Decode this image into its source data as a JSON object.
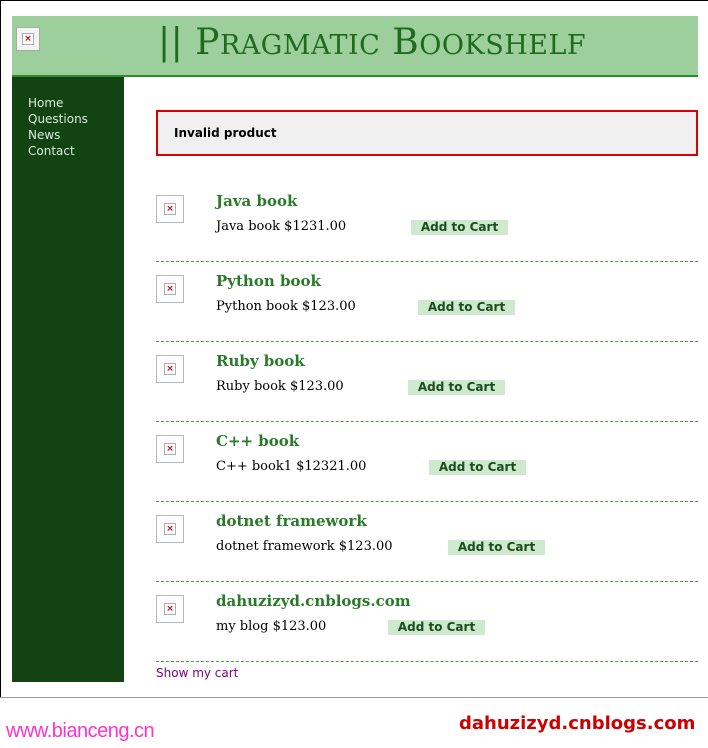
{
  "header": {
    "brand_first": "|| P",
    "brand_part1": "RAGMATIC",
    "brand_b": " B",
    "brand_part2": "OOKSHELF",
    "logo_icon": "broken-image-icon"
  },
  "nav": {
    "items": [
      "Home",
      "Questions",
      "News",
      "Contact"
    ]
  },
  "notice": {
    "text": "Invalid product"
  },
  "products": [
    {
      "title": "Java book",
      "desc": "Java book $1231.00",
      "button": "Add to Cart"
    },
    {
      "title": "Python book",
      "desc": "Python book $123.00",
      "button": "Add to Cart"
    },
    {
      "title": "Ruby book",
      "desc": "Ruby book $123.00",
      "button": "Add to Cart"
    },
    {
      "title": "C++ book",
      "desc": "C++ book1 $12321.00",
      "button": "Add to Cart"
    },
    {
      "title": "dotnet framework",
      "desc": "dotnet framework $123.00",
      "button": "Add to Cart"
    },
    {
      "title": "dahuzizyd.cnblogs.com",
      "desc": "my blog $123.00",
      "button": "Add to Cart"
    }
  ],
  "cart_link": "Show my cart",
  "watermarks": {
    "left": "www.bianceng.cn",
    "right": "dahuzizyd.cnblogs.com"
  },
  "colors": {
    "banner": "#9dcf9d",
    "sidebar": "#134313",
    "notice_border": "#dd0000",
    "button": "#cfe9cf"
  }
}
